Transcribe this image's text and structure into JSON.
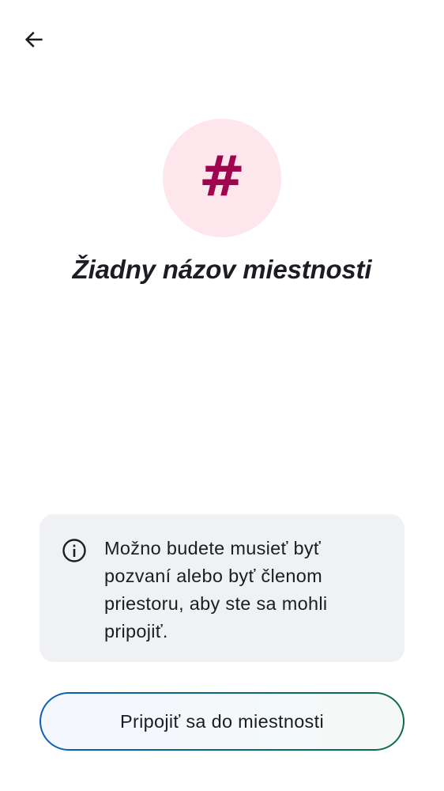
{
  "colors": {
    "background": "#ffffff",
    "avatar_bg": "#fde6ec",
    "avatar_glyph": "#a0064f",
    "text_primary": "#1b1d22",
    "card_bg": "#f0f1f4",
    "button_border_start": "#0b5fb9",
    "button_border_end": "#0c6b46"
  },
  "header": {
    "back_icon": "arrow-left-icon"
  },
  "room": {
    "avatar_glyph": "#",
    "title": "Žiadny názov miestnosti"
  },
  "notice": {
    "icon": "info-icon",
    "text": "Možno budete musieť byť pozvaní alebo byť členom priestoru, aby ste sa mohli pripojiť."
  },
  "actions": {
    "join_label": "Pripojiť sa do miestnosti"
  }
}
